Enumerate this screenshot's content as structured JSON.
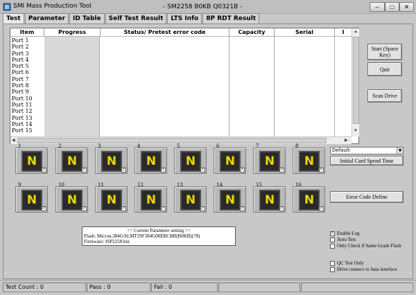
{
  "window": {
    "app_title": "SMI Mass Production Tool",
    "title": "- SM2258 B0KB Q0321B -",
    "min_label": "–",
    "max_label": "□",
    "close_label": "✕"
  },
  "tabs": [
    "Test",
    "Parameter",
    "ID Table",
    "Self Test Result",
    "LTS Info",
    "8P RDT Result"
  ],
  "table": {
    "columns": [
      "Item",
      "Progress",
      "Status/ Pretest error code",
      "Capacity",
      "Serial",
      "I"
    ],
    "ports": [
      "Port 1",
      "Port 2",
      "Port 3",
      "Port 4",
      "Port 5",
      "Port 6",
      "Port 7",
      "Port 8",
      "Port 9",
      "Port 10",
      "Port 11",
      "Port 12",
      "Port 13",
      "Port 14",
      "Port 15"
    ]
  },
  "buttons": {
    "start": "Start (Space Key)",
    "quit": "Quit",
    "scan_drive": "Scan Drive",
    "initial_card_spend_time": "Initial Card Spend Time",
    "error_code_define": "Error Code Define"
  },
  "dropdown": {
    "selected": "Default"
  },
  "slots": [
    {
      "num": "1",
      "glyph": "N"
    },
    {
      "num": "2",
      "glyph": "N"
    },
    {
      "num": "3",
      "glyph": "N"
    },
    {
      "num": "4",
      "glyph": "N"
    },
    {
      "num": "5",
      "glyph": "N"
    },
    {
      "num": "6",
      "glyph": "N"
    },
    {
      "num": "7",
      "glyph": "N"
    },
    {
      "num": "8",
      "glyph": "N"
    },
    {
      "num": "9",
      "glyph": "N"
    },
    {
      "num": "10",
      "glyph": "N"
    },
    {
      "num": "11",
      "glyph": "N"
    },
    {
      "num": "12",
      "glyph": "N"
    },
    {
      "num": "13",
      "glyph": "N"
    },
    {
      "num": "14",
      "glyph": "N"
    },
    {
      "num": "15",
      "glyph": "N"
    },
    {
      "num": "16",
      "glyph": "N"
    }
  ],
  "param": {
    "title": "== Current Parameter setting ==",
    "flash": "Flash:   Micron,384G/ltl,MT29F384G08EBCBB(B0KB)(78)",
    "firmware": "Firmware:   ISP2258.bin"
  },
  "options": {
    "enable_log": "Enable Log",
    "auto_test": "Auto Test",
    "only_check_same_grade": "Only Check if Same Grade Flash",
    "qc_test_only": "QC Test Only",
    "drive_connect_sata": "Drive connect to Sata interface"
  },
  "status": {
    "test_count": "Test Count : 0",
    "pass": "Pass : 0",
    "fail": "Fail : 0"
  }
}
